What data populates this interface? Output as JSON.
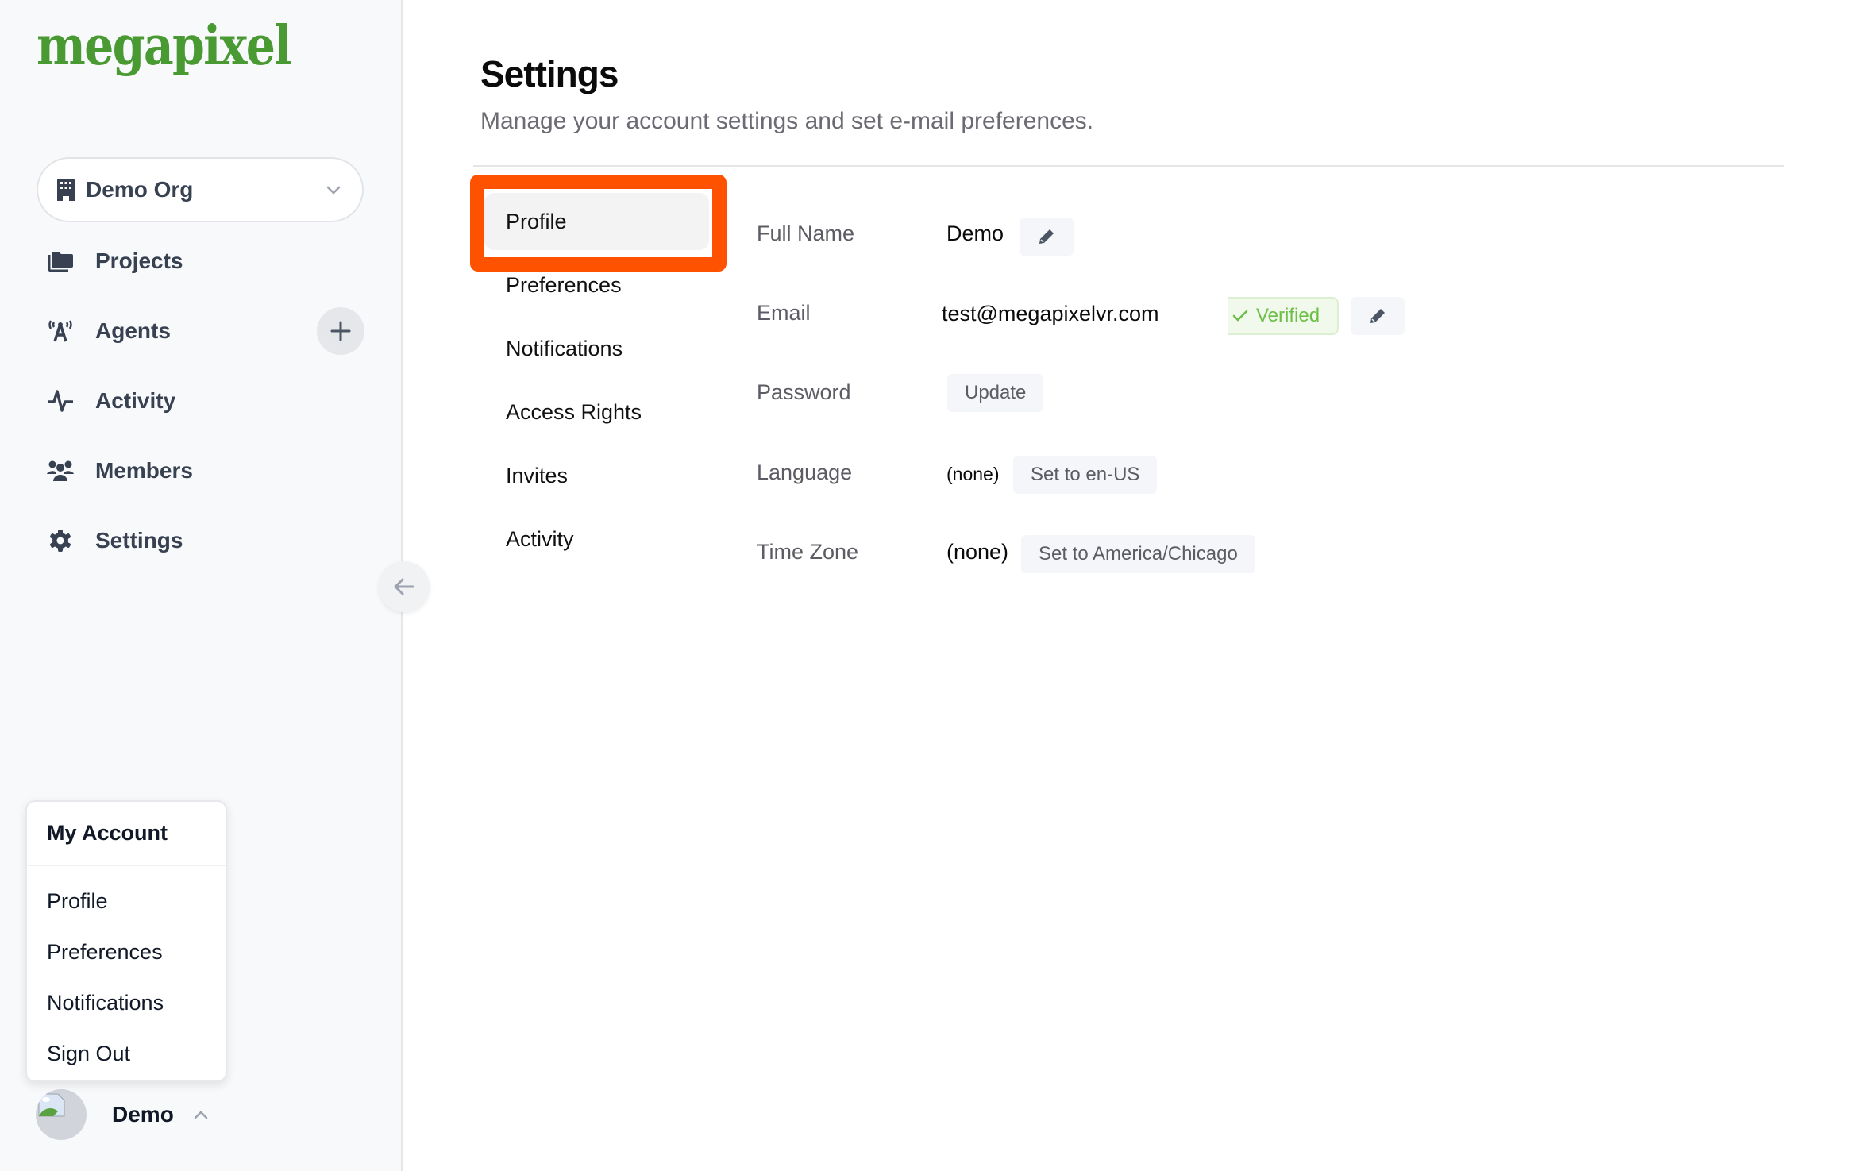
{
  "sidebar": {
    "logo": "megapixel",
    "org": {
      "name": "Demo Org",
      "icon": "building-icon",
      "chevron": "chevron-down-icon"
    },
    "nav": [
      {
        "label": "Projects",
        "icon": "folder-icon"
      },
      {
        "label": "Agents",
        "icon": "antenna-icon",
        "action_icon": "plus-icon"
      },
      {
        "label": "Activity",
        "icon": "pulse-icon"
      },
      {
        "label": "Members",
        "icon": "users-icon"
      },
      {
        "label": "Settings",
        "icon": "gear-icon"
      }
    ],
    "collapse_icon": "arrow-left-icon",
    "account_menu": {
      "header": "My Account",
      "items": [
        "Profile",
        "Preferences",
        "Notifications",
        "Sign Out"
      ]
    },
    "user": {
      "name": "Demo",
      "chevron": "chevron-up-icon"
    }
  },
  "main": {
    "title": "Settings",
    "subtitle": "Manage your account settings and set e-mail preferences.",
    "tabs": [
      {
        "label": "Profile",
        "active": true
      },
      {
        "label": "Preferences",
        "active": false
      },
      {
        "label": "Notifications",
        "active": false
      },
      {
        "label": "Access Rights",
        "active": false
      },
      {
        "label": "Invites",
        "active": false
      },
      {
        "label": "Activity",
        "active": false
      }
    ],
    "highlight_color": "#ff5200",
    "profile": {
      "full_name": {
        "label": "Full Name",
        "value": "Demo",
        "edit_icon": "pencil-icon"
      },
      "email": {
        "label": "Email",
        "value": "test@megapixelvr.com",
        "badge": "Verified",
        "badge_icon": "check-icon",
        "badge_color": "#6cbf45",
        "edit_icon": "pencil-icon"
      },
      "password": {
        "label": "Password",
        "button": "Update"
      },
      "language": {
        "label": "Language",
        "value": "(none)",
        "button": "Set to en-US"
      },
      "time_zone": {
        "label": "Time Zone",
        "value": "(none)",
        "button": "Set to America/Chicago"
      }
    }
  },
  "colors": {
    "brand": "#4a9a34",
    "sidebar_bg": "#f8f9fb",
    "text_dark": "#374151"
  }
}
